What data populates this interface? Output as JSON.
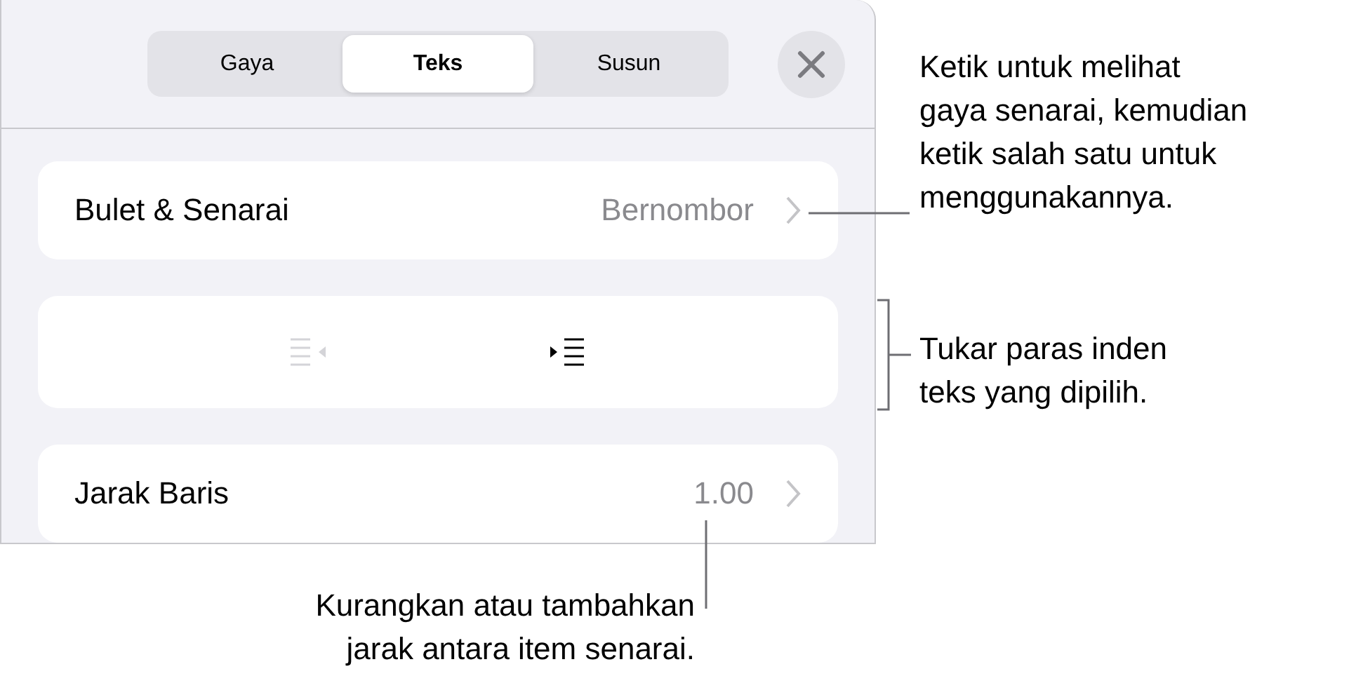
{
  "tabs": [
    {
      "label": "Gaya",
      "selected": false
    },
    {
      "label": "Teks",
      "selected": true
    },
    {
      "label": "Susun",
      "selected": false
    }
  ],
  "rows": [
    {
      "label": "Bulet & Senarai",
      "value": "Bernombor"
    },
    {
      "kind": "indent",
      "buttons": [
        {
          "kind": "decrease",
          "disabled": true
        },
        {
          "kind": "increase",
          "disabled": false
        }
      ]
    },
    {
      "label": "Jarak Baris",
      "value": "1.00"
    }
  ],
  "callouts": [
    {
      "text": "Ketik untuk melihat\ngaya senarai, kemudian\nketik salah satu untuk\nmenggunakannya.",
      "kind": "line"
    },
    {
      "text": "Tukar paras inden\nteks yang dipilih.",
      "kind": "bracket"
    },
    {
      "text": "Kurangkan atau tambahkan\njarak antara item senarai.",
      "kind": "below"
    }
  ]
}
